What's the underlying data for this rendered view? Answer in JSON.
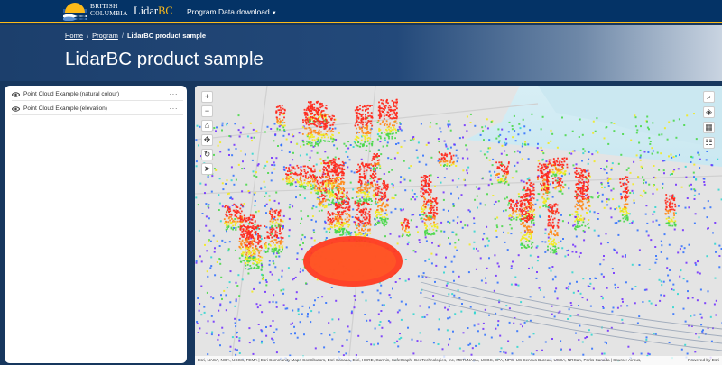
{
  "header": {
    "logo_line1": "BRITISH",
    "logo_line2": "COLUMBIA",
    "brand_prefix": "Lidar",
    "brand_suffix": "BC",
    "nav": [
      {
        "label": "Program"
      },
      {
        "label": "Data download"
      }
    ]
  },
  "breadcrumb": {
    "home": "Home",
    "program": "Program",
    "current": "LidarBC product sample"
  },
  "page_title": "LidarBC product sample",
  "layers": [
    {
      "label": "Point Cloud Example (natural colour)",
      "icon": "eye-icon",
      "menu": "···"
    },
    {
      "label": "Point Cloud Example (elevation)",
      "icon": "eye-icon",
      "menu": "···"
    }
  ],
  "map": {
    "left_tools": [
      {
        "name": "zoom-in",
        "glyph": "+"
      },
      {
        "name": "zoom-out",
        "glyph": "−"
      },
      {
        "name": "home",
        "glyph": "⌂"
      },
      {
        "name": "pan",
        "glyph": "✥"
      },
      {
        "name": "rotate",
        "glyph": "↻"
      },
      {
        "name": "compass",
        "glyph": "➤"
      }
    ],
    "right_tools": [
      {
        "name": "search",
        "glyph": "⌕"
      },
      {
        "name": "layers",
        "glyph": "◈"
      },
      {
        "name": "basemap",
        "glyph": "▦"
      },
      {
        "name": "legend",
        "glyph": "☷"
      }
    ],
    "attribution": "Esri, NASA, NGA, USGS, FEMA | Esri Community Maps Contributors, Esri Canada, Esri, HERE, Garmin, SafeGraph, GeoTechnologies, Inc, METI/NASA, USGS, EPA, NPS, US Census Bureau, USDA, NRCan, Parks Canada | Source: Airbus,",
    "powered_by": "Powered by Esri",
    "colors": {
      "red": "#ff2a1e",
      "orange": "#ff8a1a",
      "yellow": "#f2ea20",
      "green": "#4cd84c",
      "cyan": "#2ad6d0",
      "blue": "#2b6dff",
      "violet": "#6f2bff",
      "water": "#bfe4ef",
      "ground": "#e6e6e6"
    }
  }
}
